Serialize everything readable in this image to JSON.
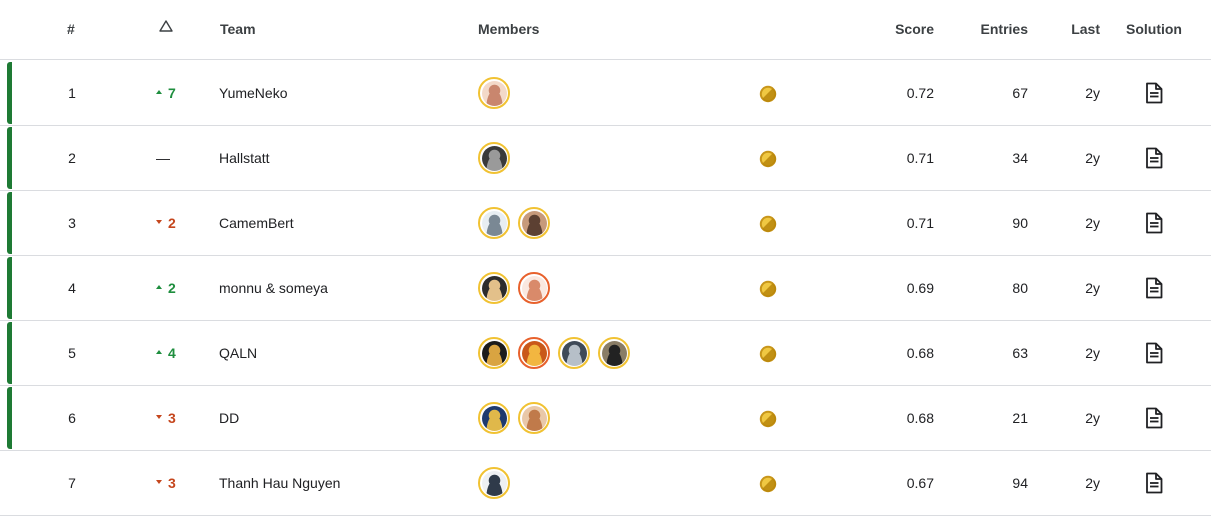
{
  "header": {
    "rank": "#",
    "delta_icon": "triangle-outline-icon",
    "team": "Team",
    "members": "Members",
    "score": "Score",
    "entries": "Entries",
    "last": "Last",
    "solution": "Solution"
  },
  "colors": {
    "medal_bar": "#1e7a34",
    "up": "#1e8e3e",
    "down": "#c5461d",
    "gold": "#d4a017",
    "avatar_ring_gold": "#f1c232",
    "avatar_ring_orange": "#e8612c"
  },
  "rows": [
    {
      "rank": "1",
      "delta": "7",
      "dir": "up",
      "team": "YumeNeko",
      "medal": true,
      "score": "0.72",
      "entries": "67",
      "last": "2y",
      "members": [
        {
          "ring": "gold",
          "c1": "#f3d9c9",
          "c2": "#c9866e"
        }
      ]
    },
    {
      "rank": "2",
      "delta": "—",
      "dir": "none",
      "team": "Hallstatt",
      "medal": true,
      "score": "0.71",
      "entries": "34",
      "last": "2y",
      "members": [
        {
          "ring": "gold",
          "c1": "#3a3a3a",
          "c2": "#9a9a9a"
        }
      ]
    },
    {
      "rank": "3",
      "delta": "2",
      "dir": "down",
      "team": "CamemBert",
      "medal": true,
      "score": "0.71",
      "entries": "90",
      "last": "2y",
      "members": [
        {
          "ring": "gold",
          "c1": "#e8eef2",
          "c2": "#7a8894"
        },
        {
          "ring": "gold",
          "c1": "#c79a7b",
          "c2": "#5c4032"
        }
      ]
    },
    {
      "rank": "4",
      "delta": "2",
      "dir": "up",
      "team": "monnu & someya",
      "medal": true,
      "score": "0.69",
      "entries": "80",
      "last": "2y",
      "members": [
        {
          "ring": "gold",
          "c1": "#2c2c2c",
          "c2": "#e3c08a"
        },
        {
          "ring": "orange",
          "c1": "#fae8e0",
          "c2": "#d98a6a"
        }
      ]
    },
    {
      "rank": "5",
      "delta": "4",
      "dir": "up",
      "team": "QALN",
      "medal": true,
      "score": "0.68",
      "entries": "63",
      "last": "2y",
      "members": [
        {
          "ring": "gold",
          "c1": "#1c1c1c",
          "c2": "#d9a441"
        },
        {
          "ring": "orange",
          "c1": "#c9581a",
          "c2": "#f2b640"
        },
        {
          "ring": "gold",
          "c1": "#3f4a58",
          "c2": "#b6bfc8"
        },
        {
          "ring": "gold",
          "c1": "#8a7d66",
          "c2": "#222222"
        }
      ]
    },
    {
      "rank": "6",
      "delta": "3",
      "dir": "down",
      "team": "DD",
      "medal": true,
      "score": "0.68",
      "entries": "21",
      "last": "2y",
      "members": [
        {
          "ring": "gold",
          "c1": "#1f3a6e",
          "c2": "#e0b84a"
        },
        {
          "ring": "gold",
          "c1": "#e9c8a8",
          "c2": "#c07a4a"
        }
      ]
    },
    {
      "rank": "7",
      "delta": "3",
      "dir": "down",
      "team": "Thanh Hau Nguyen",
      "medal": false,
      "score": "0.67",
      "entries": "94",
      "last": "2y",
      "members": [
        {
          "ring": "gold",
          "c1": "#eef0f3",
          "c2": "#2f3a4a"
        }
      ]
    }
  ]
}
